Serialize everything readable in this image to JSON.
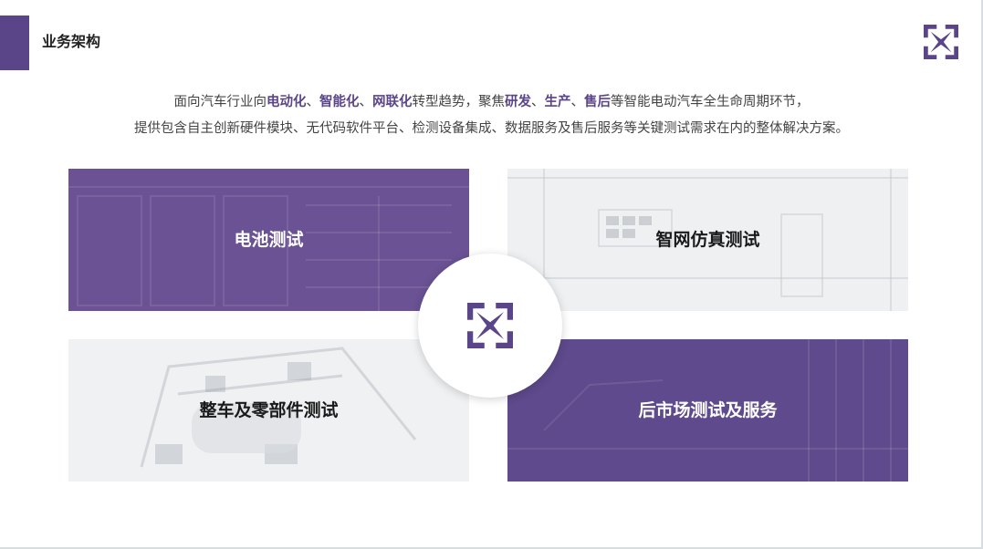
{
  "header": {
    "title": "业务架构",
    "logo_icon": "brand-x-logo-icon"
  },
  "intro": {
    "line1": [
      {
        "text": "面向汽车行业向",
        "highlight": false
      },
      {
        "text": "电动化",
        "highlight": true
      },
      {
        "text": "、",
        "highlight": false
      },
      {
        "text": "智能化",
        "highlight": true
      },
      {
        "text": "、",
        "highlight": false
      },
      {
        "text": "网联化",
        "highlight": true
      },
      {
        "text": "转型趋势，聚焦",
        "highlight": false
      },
      {
        "text": "研发",
        "highlight": true
      },
      {
        "text": "、",
        "highlight": false
      },
      {
        "text": "生产",
        "highlight": true
      },
      {
        "text": "、",
        "highlight": false
      },
      {
        "text": "售后",
        "highlight": true
      },
      {
        "text": "等智能电动汽车全生命周期环节，",
        "highlight": false
      }
    ],
    "line2": "提供包含自主创新硬件模块、无代码软件平台、检测设备集成、数据服务及售后服务等关键测试需求在内的整体解决方案。"
  },
  "tiles": {
    "battery": "电池测试",
    "adas": "智网仿真测试",
    "vehicle": "整车及零部件测试",
    "aftermarket": "后市场测试及服务"
  },
  "colors": {
    "brand_purple": "#5b4589",
    "highlight": "#5b4589",
    "light_tile": "#eef0f2"
  }
}
